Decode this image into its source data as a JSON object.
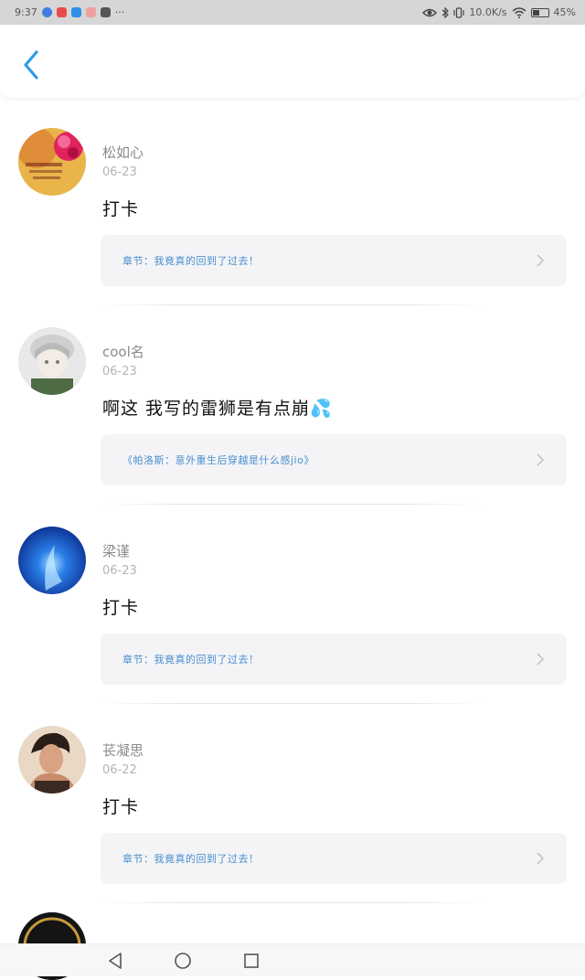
{
  "status_bar": {
    "time": "9:37",
    "more": "···",
    "network_speed": "10.0K/s",
    "battery_percent": "45%",
    "battery_level": 0.45
  },
  "header": {
    "back_icon": "chevron-left-icon",
    "accent_color": "#2f9be8"
  },
  "comments": [
    {
      "name": "松如心",
      "date": "06-23",
      "content": "打卡",
      "chapter": "章节：我竟真的回到了过去！"
    },
    {
      "name": "cool名",
      "date": "06-23",
      "content": "啊这 我写的雷狮是有点崩💦",
      "chapter": "《帕洛斯：意外重生后穿越是什么感jio》"
    },
    {
      "name": "梁谨",
      "date": "06-23",
      "content": "打卡",
      "chapter": "章节：我竟真的回到了过去！"
    },
    {
      "name": "苌凝思",
      "date": "06-22",
      "content": "打卡",
      "chapter": "章节：我竟真的回到了过去！"
    }
  ],
  "nav_bar": {
    "back": "triangle-back-icon",
    "home": "circle-home-icon",
    "recents": "square-recents-icon"
  }
}
